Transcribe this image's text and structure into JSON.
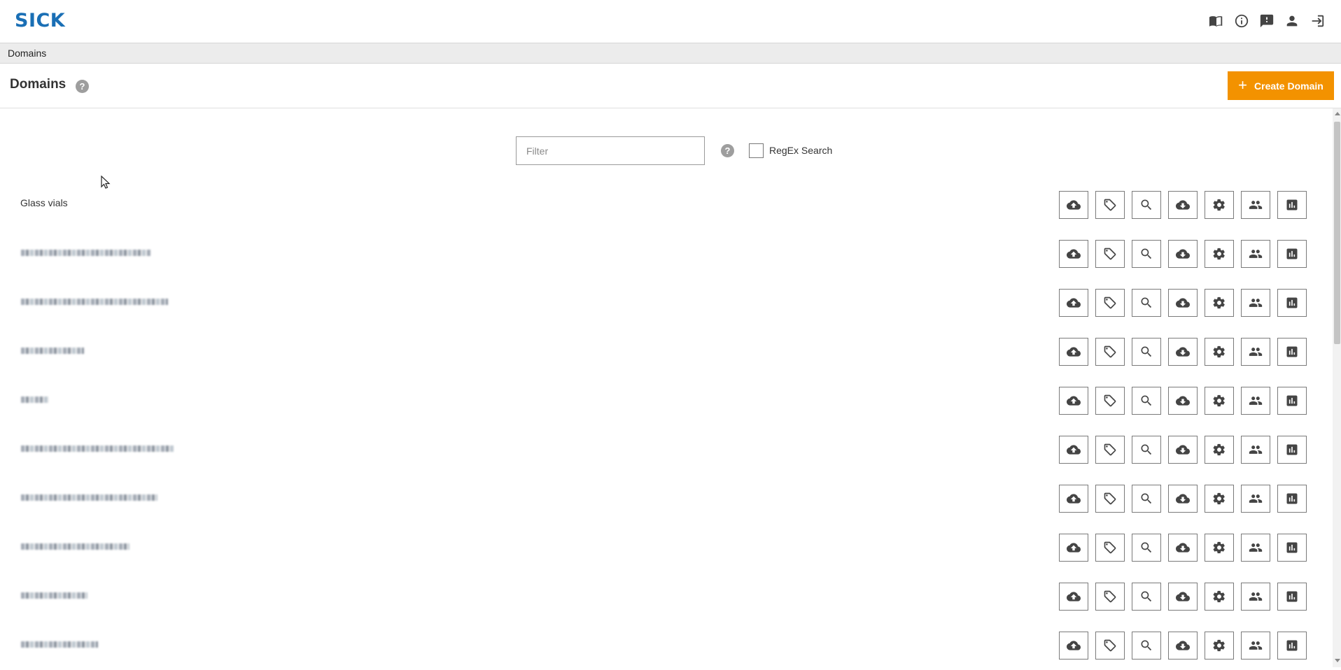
{
  "app": {
    "logo_text": "SICK"
  },
  "header": {
    "icons": [
      "book-icon",
      "info-icon",
      "feedback-icon",
      "user-icon",
      "logout-icon"
    ]
  },
  "breadcrumb": {
    "current": "Domains"
  },
  "page": {
    "title": "Domains",
    "create_button_label": "Create Domain"
  },
  "filter": {
    "placeholder": "Filter",
    "value": "",
    "regex_label": "RegEx Search",
    "regex_checked": false
  },
  "colors": {
    "brand": "#1a6fb5",
    "accent": "#f39200"
  },
  "domains": [
    {
      "name": "Glass vials",
      "obscured": false
    },
    {
      "name": "",
      "obscured": true
    },
    {
      "name": "",
      "obscured": true
    },
    {
      "name": "",
      "obscured": true
    },
    {
      "name": "",
      "obscured": true
    },
    {
      "name": "",
      "obscured": true
    },
    {
      "name": "",
      "obscured": true
    },
    {
      "name": "",
      "obscured": true
    },
    {
      "name": "",
      "obscured": true
    },
    {
      "name": "",
      "obscured": true
    }
  ],
  "row_actions": [
    "upload-icon",
    "tag-icon",
    "search-icon",
    "download-icon",
    "settings-icon",
    "users-icon",
    "statistics-icon"
  ]
}
